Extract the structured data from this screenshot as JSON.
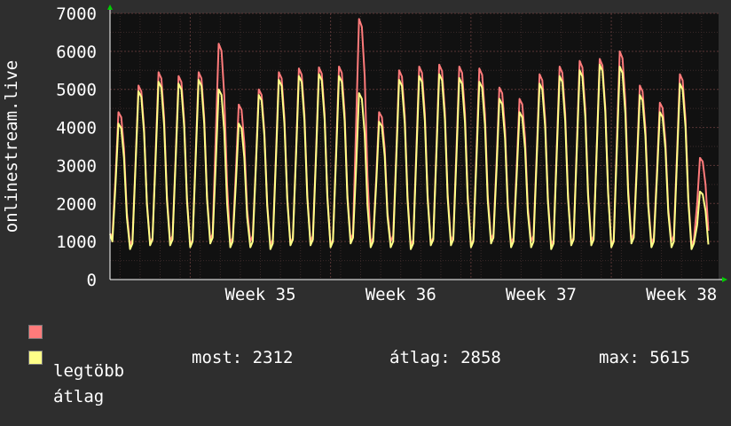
{
  "chart_data": {
    "type": "line",
    "ylabel": "onlinestream.live",
    "ylim": [
      0,
      7000
    ],
    "yticks": [
      0,
      1000,
      2000,
      3000,
      4000,
      5000,
      6000,
      7000
    ],
    "xticks": [
      "Week 35",
      "Week 36",
      "Week 37",
      "Week 38"
    ],
    "grid": true,
    "series": [
      {
        "name": "legtöbb",
        "color": "#ff7b7b",
        "values": [
          4400,
          5100,
          5450,
          5350,
          5450,
          6200,
          4600,
          5000,
          5450,
          5550,
          5580,
          5600,
          6850,
          4400,
          5500,
          5600,
          5650,
          5600,
          5550,
          5050,
          4750,
          5400,
          5600,
          5750,
          5800,
          6000,
          5100,
          4650,
          5400,
          3200
        ]
      },
      {
        "name": "átlag",
        "color": "#ffff88",
        "values": [
          4100,
          4950,
          5200,
          5150,
          5250,
          5000,
          4100,
          4850,
          5250,
          5350,
          5400,
          5350,
          4900,
          4150,
          5250,
          5350,
          5400,
          5300,
          5200,
          4750,
          4400,
          5150,
          5350,
          5500,
          5650,
          5600,
          4850,
          4400,
          5150,
          2312
        ]
      }
    ]
  },
  "legend": {
    "max_label": "legtöbb",
    "avg_label": "átlag",
    "max_color": "#ff7b7b",
    "avg_color": "#ffff88"
  },
  "stats": {
    "now_text": "most: 2312",
    "avg_text": "átlag: 2858",
    "max_text": "max: 5615"
  },
  "colors": {
    "background": "#2e2e2e",
    "plot_background": "#111111",
    "grid_major": "#5a3636",
    "grid_minor": "#3a2a2a",
    "axis": "#ffffff",
    "arrow": "#00cc00"
  }
}
